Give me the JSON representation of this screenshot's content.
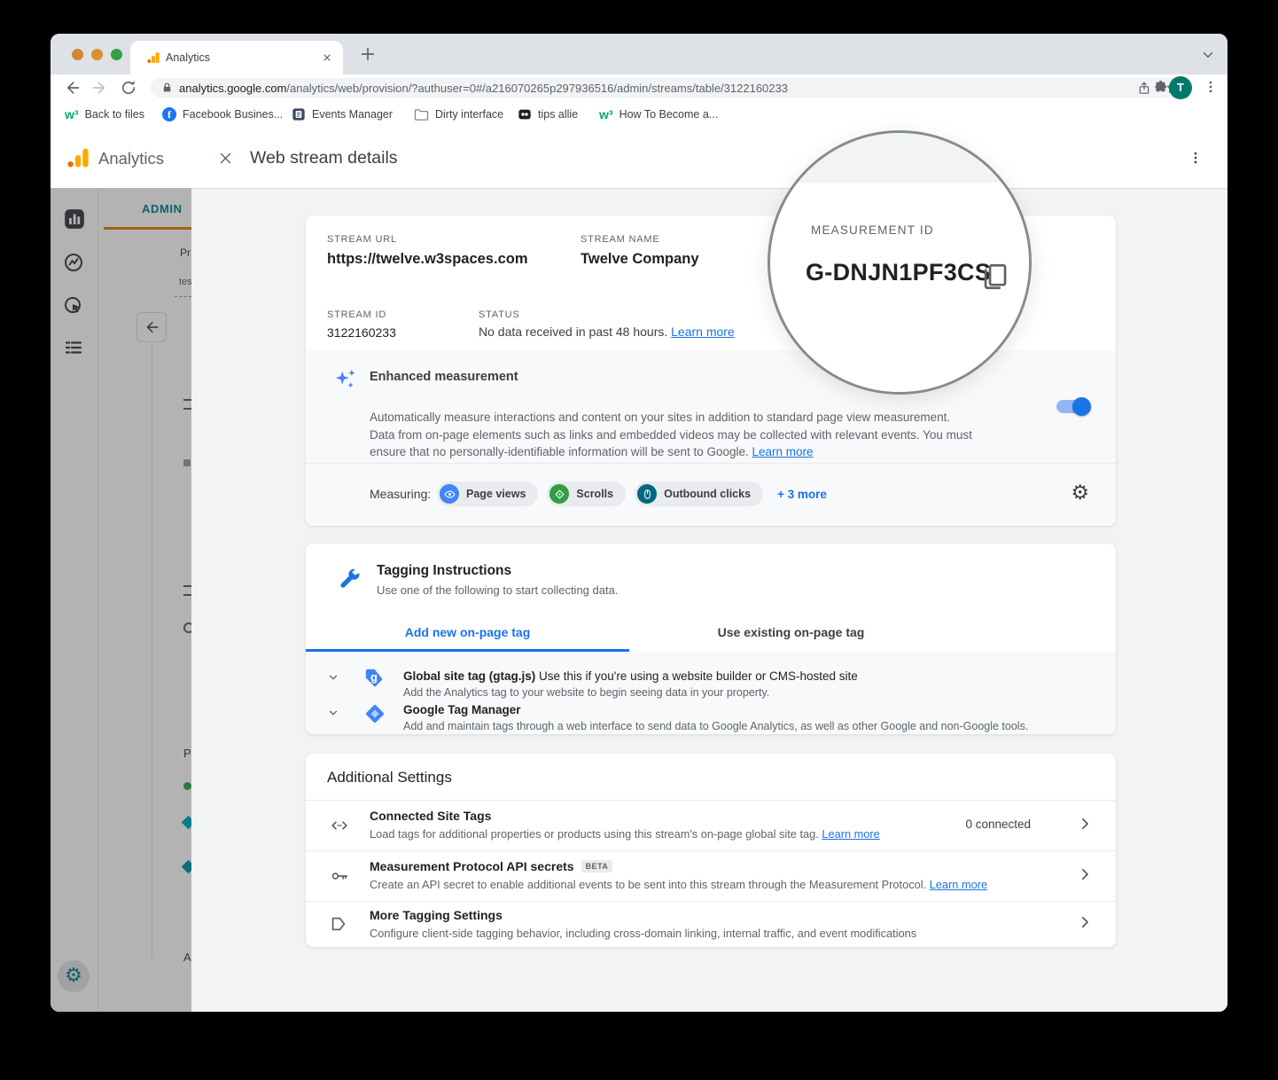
{
  "browser": {
    "tab_title": "Analytics",
    "url_domain": "analytics.google.com",
    "url_path": "/analytics/web/provision/?authuser=0#/a216070265p297936516/admin/streams/table/3122160233",
    "avatar_initial": "T",
    "bookmarks": [
      {
        "label": "Back to files",
        "icon_glyph": "w³"
      },
      {
        "label": "Facebook Busines...",
        "icon_glyph": "f"
      },
      {
        "label": "Events Manager"
      },
      {
        "label": "Dirty interface"
      },
      {
        "label": "tips allie"
      },
      {
        "label": "How To Become a...",
        "icon_glyph": "w³"
      }
    ]
  },
  "glyphs": {
    "gear": "⚙"
  },
  "app": {
    "brand": "Analytics",
    "admin_tab": "ADMIN",
    "fragments": {
      "property": "Pr",
      "test": "tes",
      "p": "P",
      "a": "A"
    }
  },
  "modal": {
    "title": "Web stream details",
    "stream": {
      "url_label": "STREAM URL",
      "url": "https://twelve.w3spaces.com",
      "name_label": "STREAM NAME",
      "name": "Twelve Company",
      "id_label": "STREAM ID",
      "id": "3122160233",
      "status_label": "STATUS",
      "status": "No data received in past 48 hours.",
      "status_link": "Learn more"
    },
    "magnifier": {
      "label": "MEASUREMENT ID",
      "value": "G-DNJN1PF3CS"
    },
    "enhanced": {
      "title": "Enhanced measurement",
      "line1": "Automatically measure interactions and content on your sites in addition to standard page view measurement.",
      "line2": "Data from on-page elements such as links and embedded videos may be collected with relevant events. You must ensure that no personally-identifiable information will be sent to Google.",
      "link": "Learn more",
      "measuring_label": "Measuring:",
      "chips": [
        {
          "label": "Page views"
        },
        {
          "label": "Scrolls"
        },
        {
          "label": "Outbound clicks"
        }
      ],
      "more": "+ 3 more"
    },
    "tagging": {
      "title": "Tagging Instructions",
      "subtitle": "Use one of the following to start collecting data.",
      "tabs": [
        {
          "label": "Add new on-page tag"
        },
        {
          "label": "Use existing on-page tag"
        }
      ],
      "rows": [
        {
          "title_bold": "Global site tag (gtag.js)",
          "title_rest": " Use this if you're using a website builder or CMS-hosted site",
          "subtitle": "Add the Analytics tag to your website to begin seeing data in your property.",
          "icon_letter": "g"
        },
        {
          "title_bold": "Google Tag Manager",
          "title_rest": "",
          "subtitle": "Add and maintain tags through a web interface to send data to Google Analytics, as well as other Google and non-Google tools."
        }
      ]
    },
    "additional": {
      "title": "Additional Settings",
      "rows": [
        {
          "title": "Connected Site Tags",
          "subtitle": "Load tags for additional properties or products using this stream's on-page global site tag.",
          "link": "Learn more",
          "value": "0 connected"
        },
        {
          "title": "Measurement Protocol API secrets",
          "badge": "BETA",
          "subtitle": "Create an API secret to enable additional events to be sent into this stream through the Measurement Protocol.",
          "link": "Learn more"
        },
        {
          "title": "More Tagging Settings",
          "subtitle": "Configure client-side tagging behavior, including cross-domain linking, internal traffic, and event modifications"
        }
      ]
    }
  }
}
